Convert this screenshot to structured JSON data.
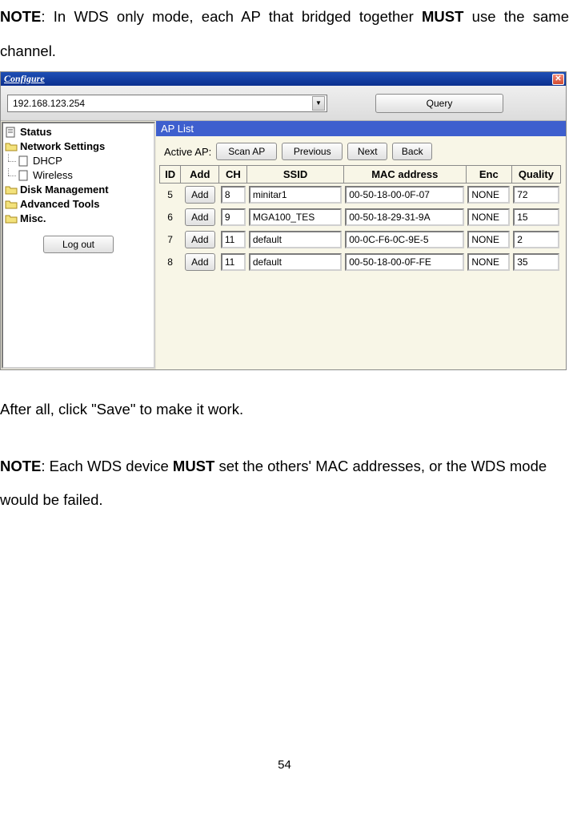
{
  "body": {
    "note1_prefix": "NOTE",
    "note1_part1": ": In WDS only mode, each AP that bridged together ",
    "note1_must": "MUST",
    "note1_part2": " use the same channel.",
    "after_all": "After all, click \"Save\" to make it work.",
    "note2_prefix": "NOTE",
    "note2_part1": ": Each WDS device ",
    "note2_must": "MUST",
    "note2_part2": " set the others' MAC addresses, or the WDS mode would be failed.",
    "page_number": "54"
  },
  "window": {
    "title": "Configure",
    "query_label": "Query",
    "address": "192.168.123.254"
  },
  "sidebar": {
    "status": "Status",
    "network": "Network Settings",
    "dhcp": "DHCP",
    "wireless": "Wireless",
    "disk": "Disk Management",
    "advanced": "Advanced Tools",
    "misc": "Misc.",
    "logout": "Log out"
  },
  "aplist": {
    "header": "AP List",
    "active_label": "Active AP:",
    "scan": "Scan AP",
    "previous": "Previous",
    "next": "Next",
    "back": "Back",
    "add_label": "Add",
    "columns": {
      "id": "ID",
      "add": "Add",
      "ch": "CH",
      "ssid": "SSID",
      "mac": "MAC address",
      "enc": "Enc",
      "quality": "Quality"
    },
    "rows": [
      {
        "id": "5",
        "ch": "8",
        "ssid": "minitar1",
        "mac": "00-50-18-00-0F-07",
        "enc": "NONE",
        "quality": "72"
      },
      {
        "id": "6",
        "ch": "9",
        "ssid": "MGA100_TES",
        "mac": "00-50-18-29-31-9A",
        "enc": "NONE",
        "quality": "15"
      },
      {
        "id": "7",
        "ch": "11",
        "ssid": "default",
        "mac": "00-0C-F6-0C-9E-5",
        "enc": "NONE",
        "quality": "2"
      },
      {
        "id": "8",
        "ch": "11",
        "ssid": "default",
        "mac": "00-50-18-00-0F-FE",
        "enc": "NONE",
        "quality": "35"
      }
    ]
  }
}
